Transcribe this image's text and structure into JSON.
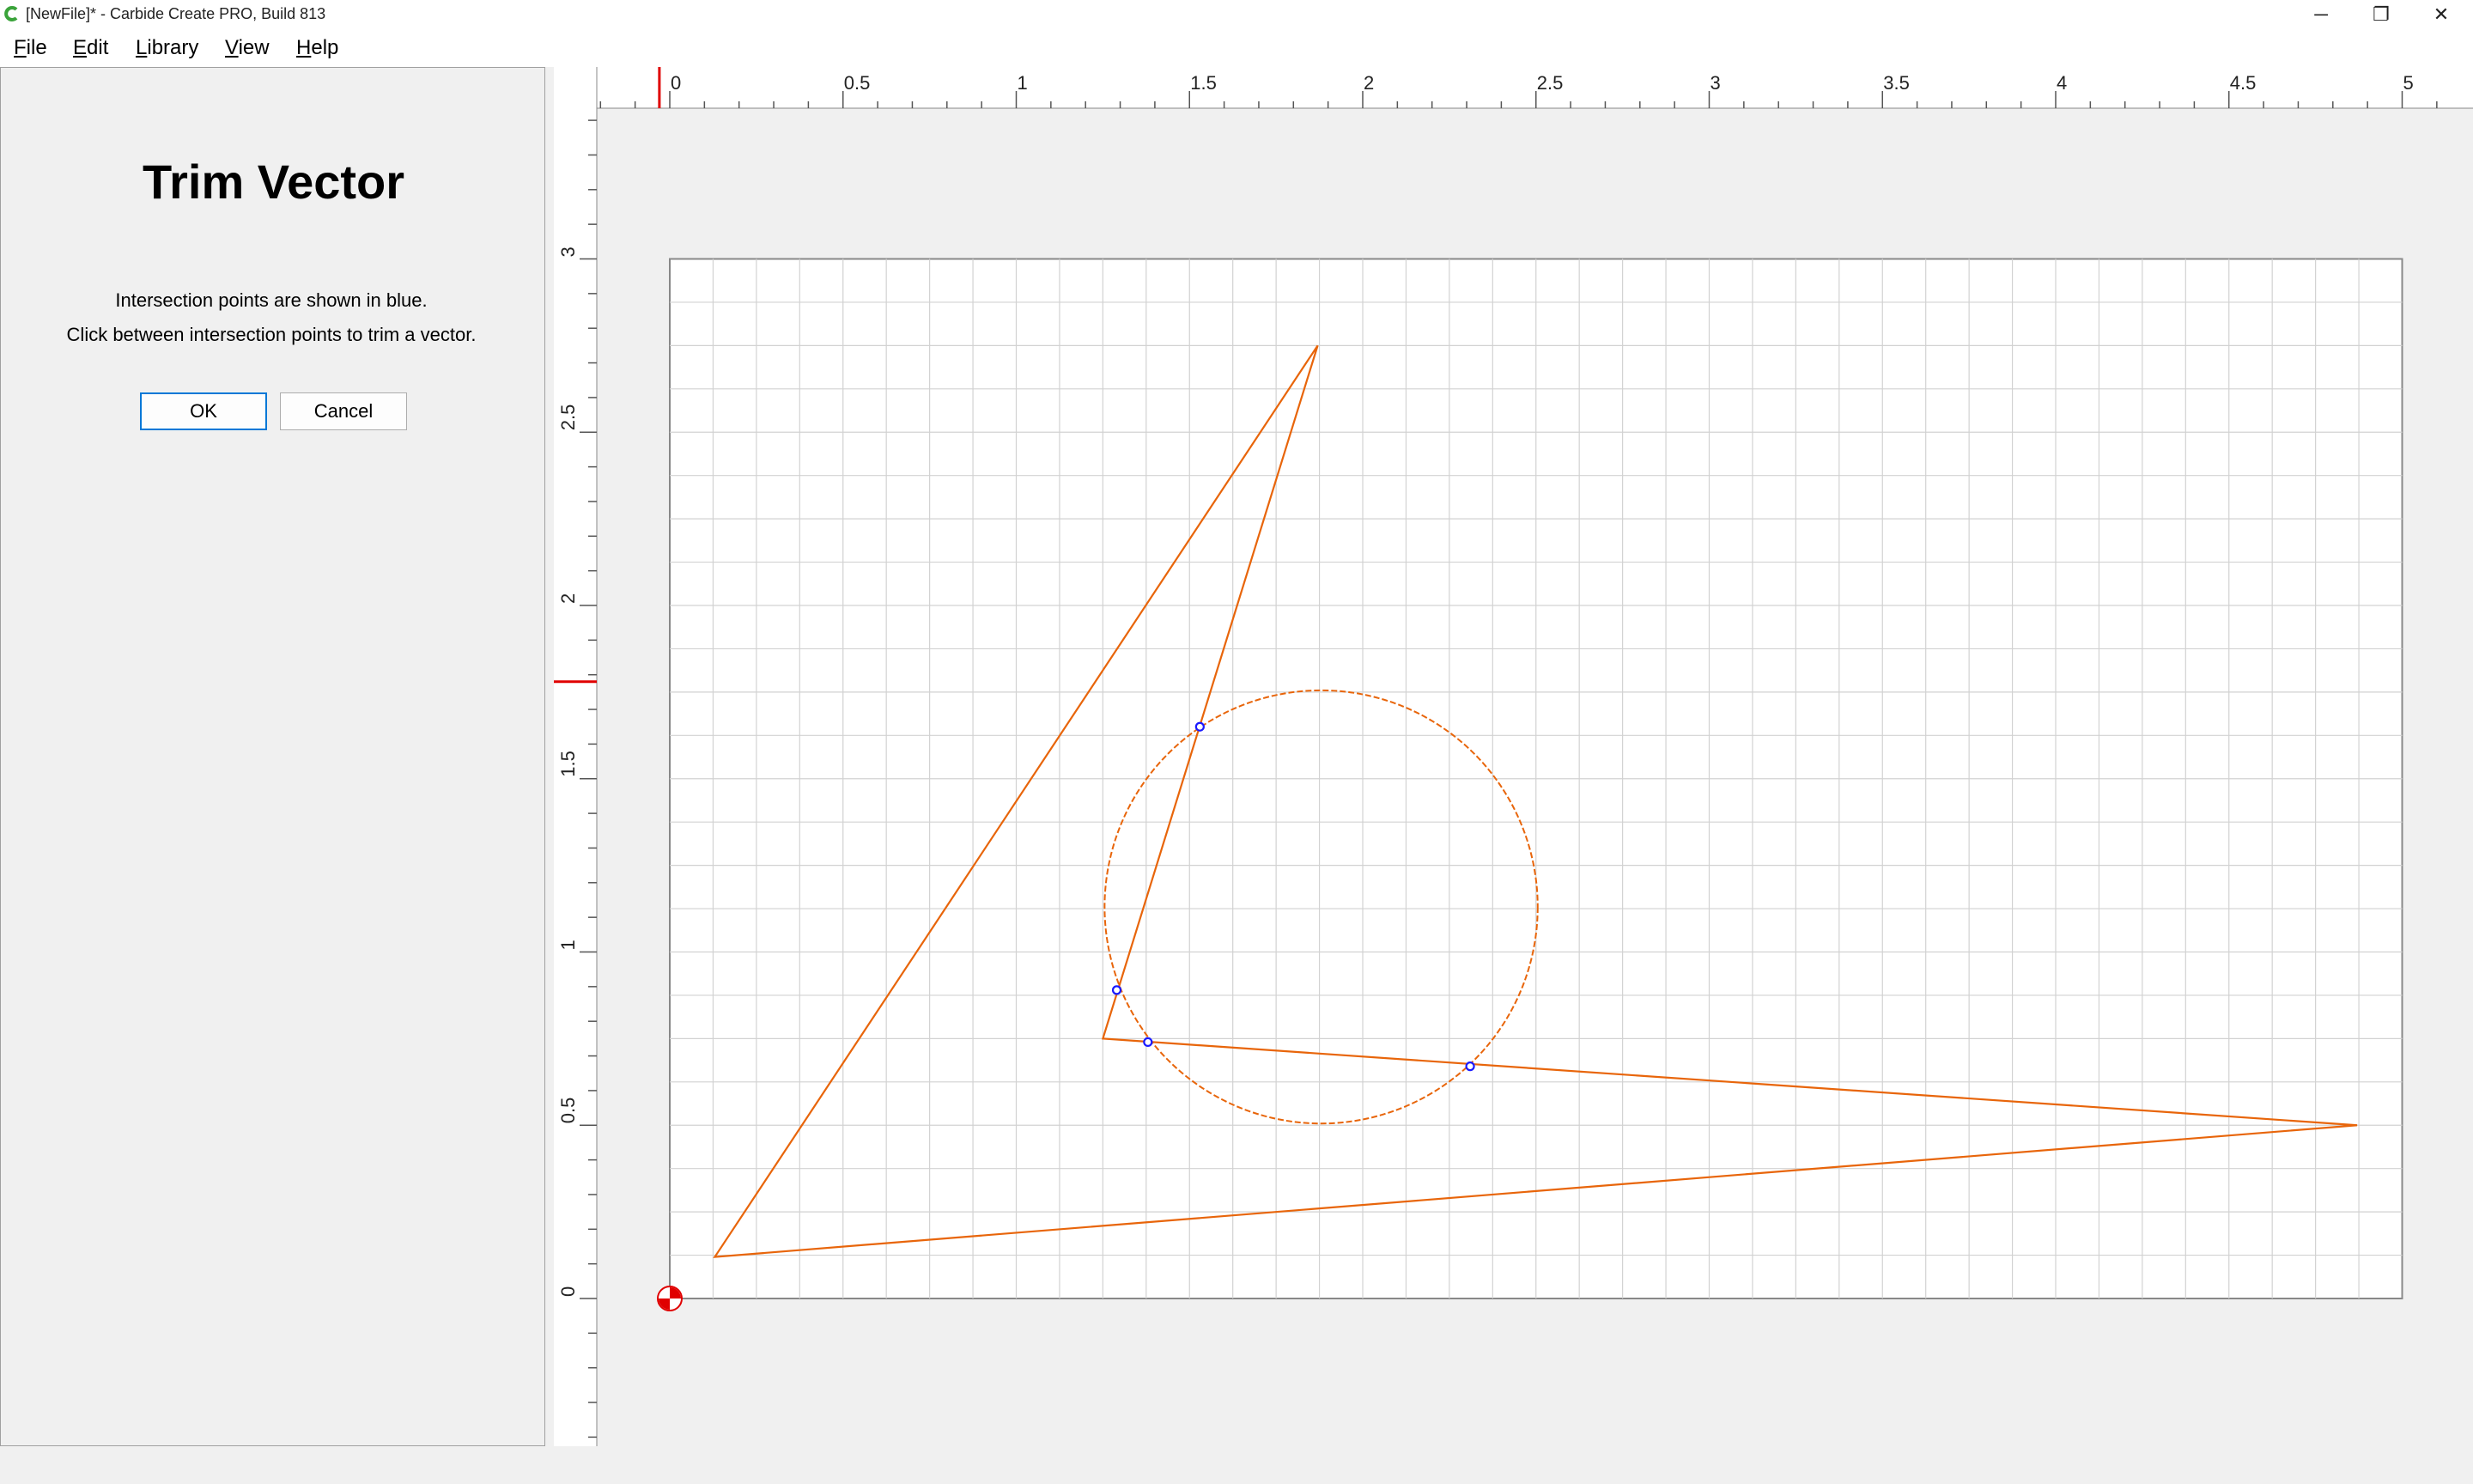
{
  "window": {
    "title": "[NewFile]* - Carbide Create PRO, Build 813",
    "minimize_glyph": "─",
    "maximize_glyph": "❐",
    "close_glyph": "✕"
  },
  "menu": {
    "items": [
      {
        "label": "File"
      },
      {
        "label": "Edit"
      },
      {
        "label": "Library"
      },
      {
        "label": "View"
      },
      {
        "label": "Help"
      }
    ]
  },
  "panel": {
    "title": "Trim Vector",
    "instruction_1": "Intersection points are shown in blue.",
    "instruction_2": "Click between intersection points to trim a vector.",
    "ok_label": "OK",
    "cancel_label": "Cancel"
  },
  "rulers": {
    "x_labels": [
      "0",
      "0.5",
      "1",
      "1.5",
      "2",
      "2.5",
      "3",
      "3.5",
      "4",
      "4.5",
      "5"
    ],
    "y_labels": [
      "0",
      "0.5",
      "1",
      "1.5",
      "2",
      "2.5",
      "3"
    ],
    "cursor_x": -0.03,
    "cursor_y": 1.78
  },
  "stock": {
    "width": 5,
    "height": 3
  },
  "colors": {
    "vector": "#e8650a",
    "intersection": "#1a1aff",
    "grid": "#d2d2d2",
    "ruler_marker": "#e00000",
    "origin": "#e00000"
  },
  "geometry": {
    "triangle_1": [
      [
        0.13,
        0.12
      ],
      [
        1.87,
        2.75
      ],
      [
        1.25,
        0.75
      ],
      [
        4.87,
        0.5
      ]
    ],
    "circle": {
      "cx": 1.88,
      "cy": 1.13,
      "r": 0.625
    },
    "intersections": [
      [
        1.53,
        1.65
      ],
      [
        1.29,
        0.89
      ],
      [
        1.38,
        0.74
      ],
      [
        2.31,
        0.67
      ]
    ]
  }
}
